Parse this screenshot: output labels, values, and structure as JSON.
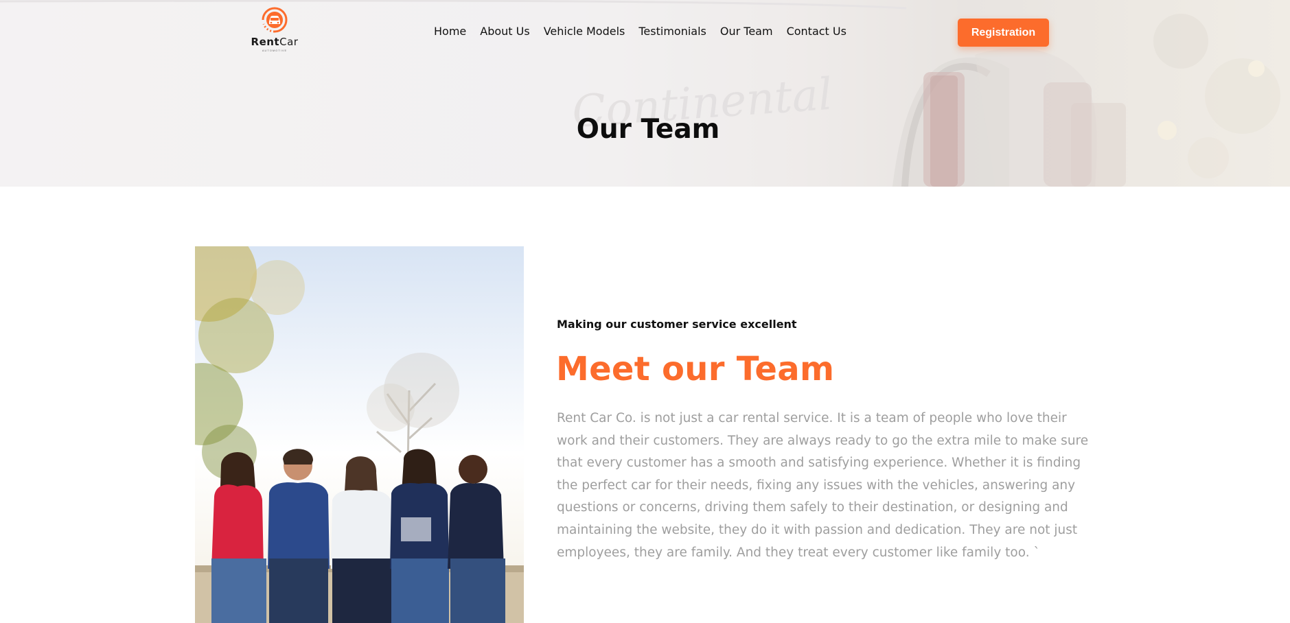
{
  "brand": {
    "name_part1": "Rent",
    "name_part2": "Car",
    "tagline": "AUTOMOTIVE",
    "accent_color": "#fc6c2c"
  },
  "nav": {
    "items": [
      "Home",
      "About Us",
      "Vehicle Models",
      "Testimonials",
      "Our Team",
      "Contact Us"
    ]
  },
  "header": {
    "registration_label": "Registration"
  },
  "hero": {
    "title": "Our Team",
    "background_script": "Continental"
  },
  "team": {
    "eyebrow": "Making our customer service excellent",
    "heading": "Meet our Team",
    "description": "Rent Car Co. is not just a car rental service. It is a team of people who love their work and their customers. They are always ready to go the extra mile to make sure that every customer has a smooth and satisfying experience. Whether it is finding the perfect car for their needs, fixing any issues with the vehicles, answering any questions or concerns, driving them safely to their destination, or designing and maintaining the website, they do it with passion and dedication. They are not just employees, they are family. And they treat every customer like family too. `",
    "photo_icon": "team-group-photo"
  }
}
